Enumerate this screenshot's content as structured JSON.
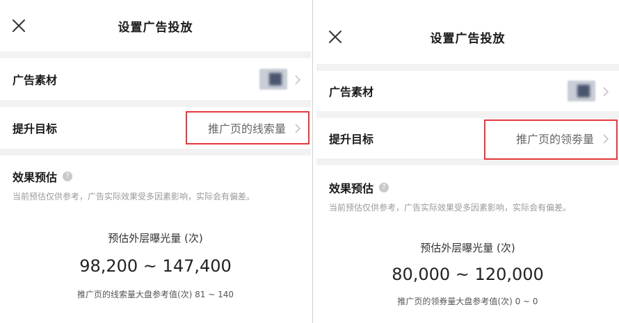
{
  "panels": [
    {
      "title": "设置广告投放",
      "material_label": "广告素材",
      "target_label": "提升目标",
      "target_value": "推广页的线索量",
      "effect_title": "效果预估",
      "help_glyph": "?",
      "effect_note": "当前预估仅供参考，广告实际效果受多因素影响，实际会有偏差。",
      "estimate_label": "预估外层曝光量 (次)",
      "estimate_value": "98,200 ~ 147,400",
      "reference_text": "推广页的线索量大盘参考值(次)  81 ~ 140"
    },
    {
      "title": "设置广告投放",
      "material_label": "广告素材",
      "target_label": "提升目标",
      "target_value": "推广页的领劵量",
      "effect_title": "效果预估",
      "help_glyph": "?",
      "effect_note": "当前预估仅供参考，广告实际效果受多因素影响，实际会有偏差。",
      "estimate_label": "预估外层曝光量 (次)",
      "estimate_value": "80,000 ~ 120,000",
      "reference_text": "推广页的领券量大盘参考值(次)  0 ~ 0"
    }
  ],
  "colors": {
    "highlight_border": "#e8373a",
    "separator": "#f2f2f2",
    "muted_text": "#9a9a9a"
  },
  "icons": {
    "close": "close-icon",
    "chevron": "chevron-right-icon",
    "help": "help-circle-icon"
  }
}
